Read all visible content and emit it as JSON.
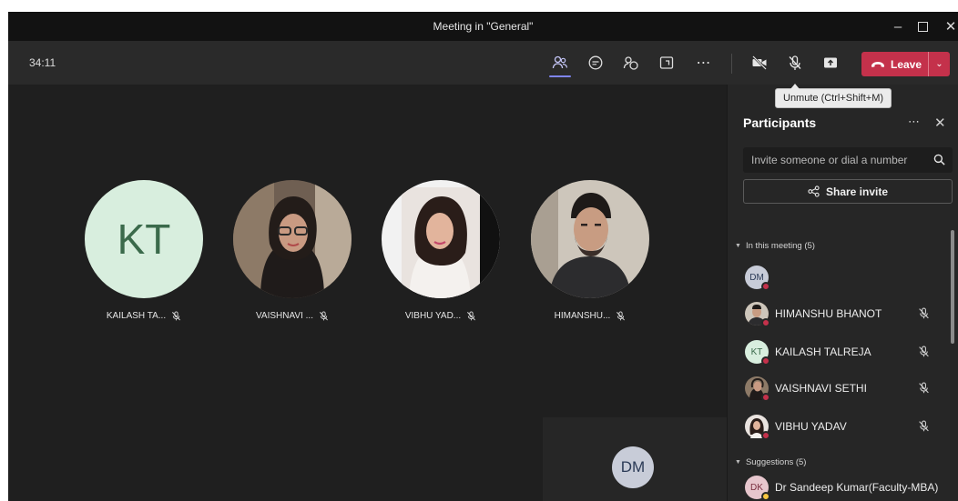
{
  "window": {
    "title": "Meeting in \"General\""
  },
  "toolbar": {
    "timer": "34:11",
    "leave_label": "Leave",
    "tooltip": "Unmute (Ctrl+Shift+M)",
    "icons": [
      "people-icon",
      "chat-icon",
      "raise-hand-icon",
      "rooms-icon",
      "more-icon",
      "camera-off-icon",
      "mic-off-icon",
      "share-tray-icon"
    ]
  },
  "stage": {
    "tiles": [
      {
        "initials": "KT",
        "name": "KAILASH TA..."
      },
      {
        "name": "VAISHNAVI ..."
      },
      {
        "name": "VIBHU YAD..."
      },
      {
        "name": "HIMANSHU..."
      }
    ],
    "self_view": {
      "initials": "DM"
    }
  },
  "panel": {
    "title": "Participants",
    "invite_placeholder": "Invite someone or dial a number",
    "share_label": "Share invite",
    "section_in_meeting": "In this meeting (5)",
    "section_suggestions": "Suggestions (5)",
    "participants": [
      {
        "initials": "DM",
        "name": ""
      },
      {
        "name": "HIMANSHU BHANOT"
      },
      {
        "initials": "KT",
        "name": "KAILASH TALREJA"
      },
      {
        "name": "VAISHNAVI SETHI"
      },
      {
        "name": "VIBHU YADAV"
      }
    ],
    "suggestions": [
      {
        "initials": "DK",
        "name": "Dr Sandeep Kumar(Faculty-MBA)"
      }
    ]
  },
  "colors": {
    "leave": "#c4314b",
    "accent": "#7f85f5",
    "panel": "#262626",
    "stage": "#1f1f1f"
  }
}
